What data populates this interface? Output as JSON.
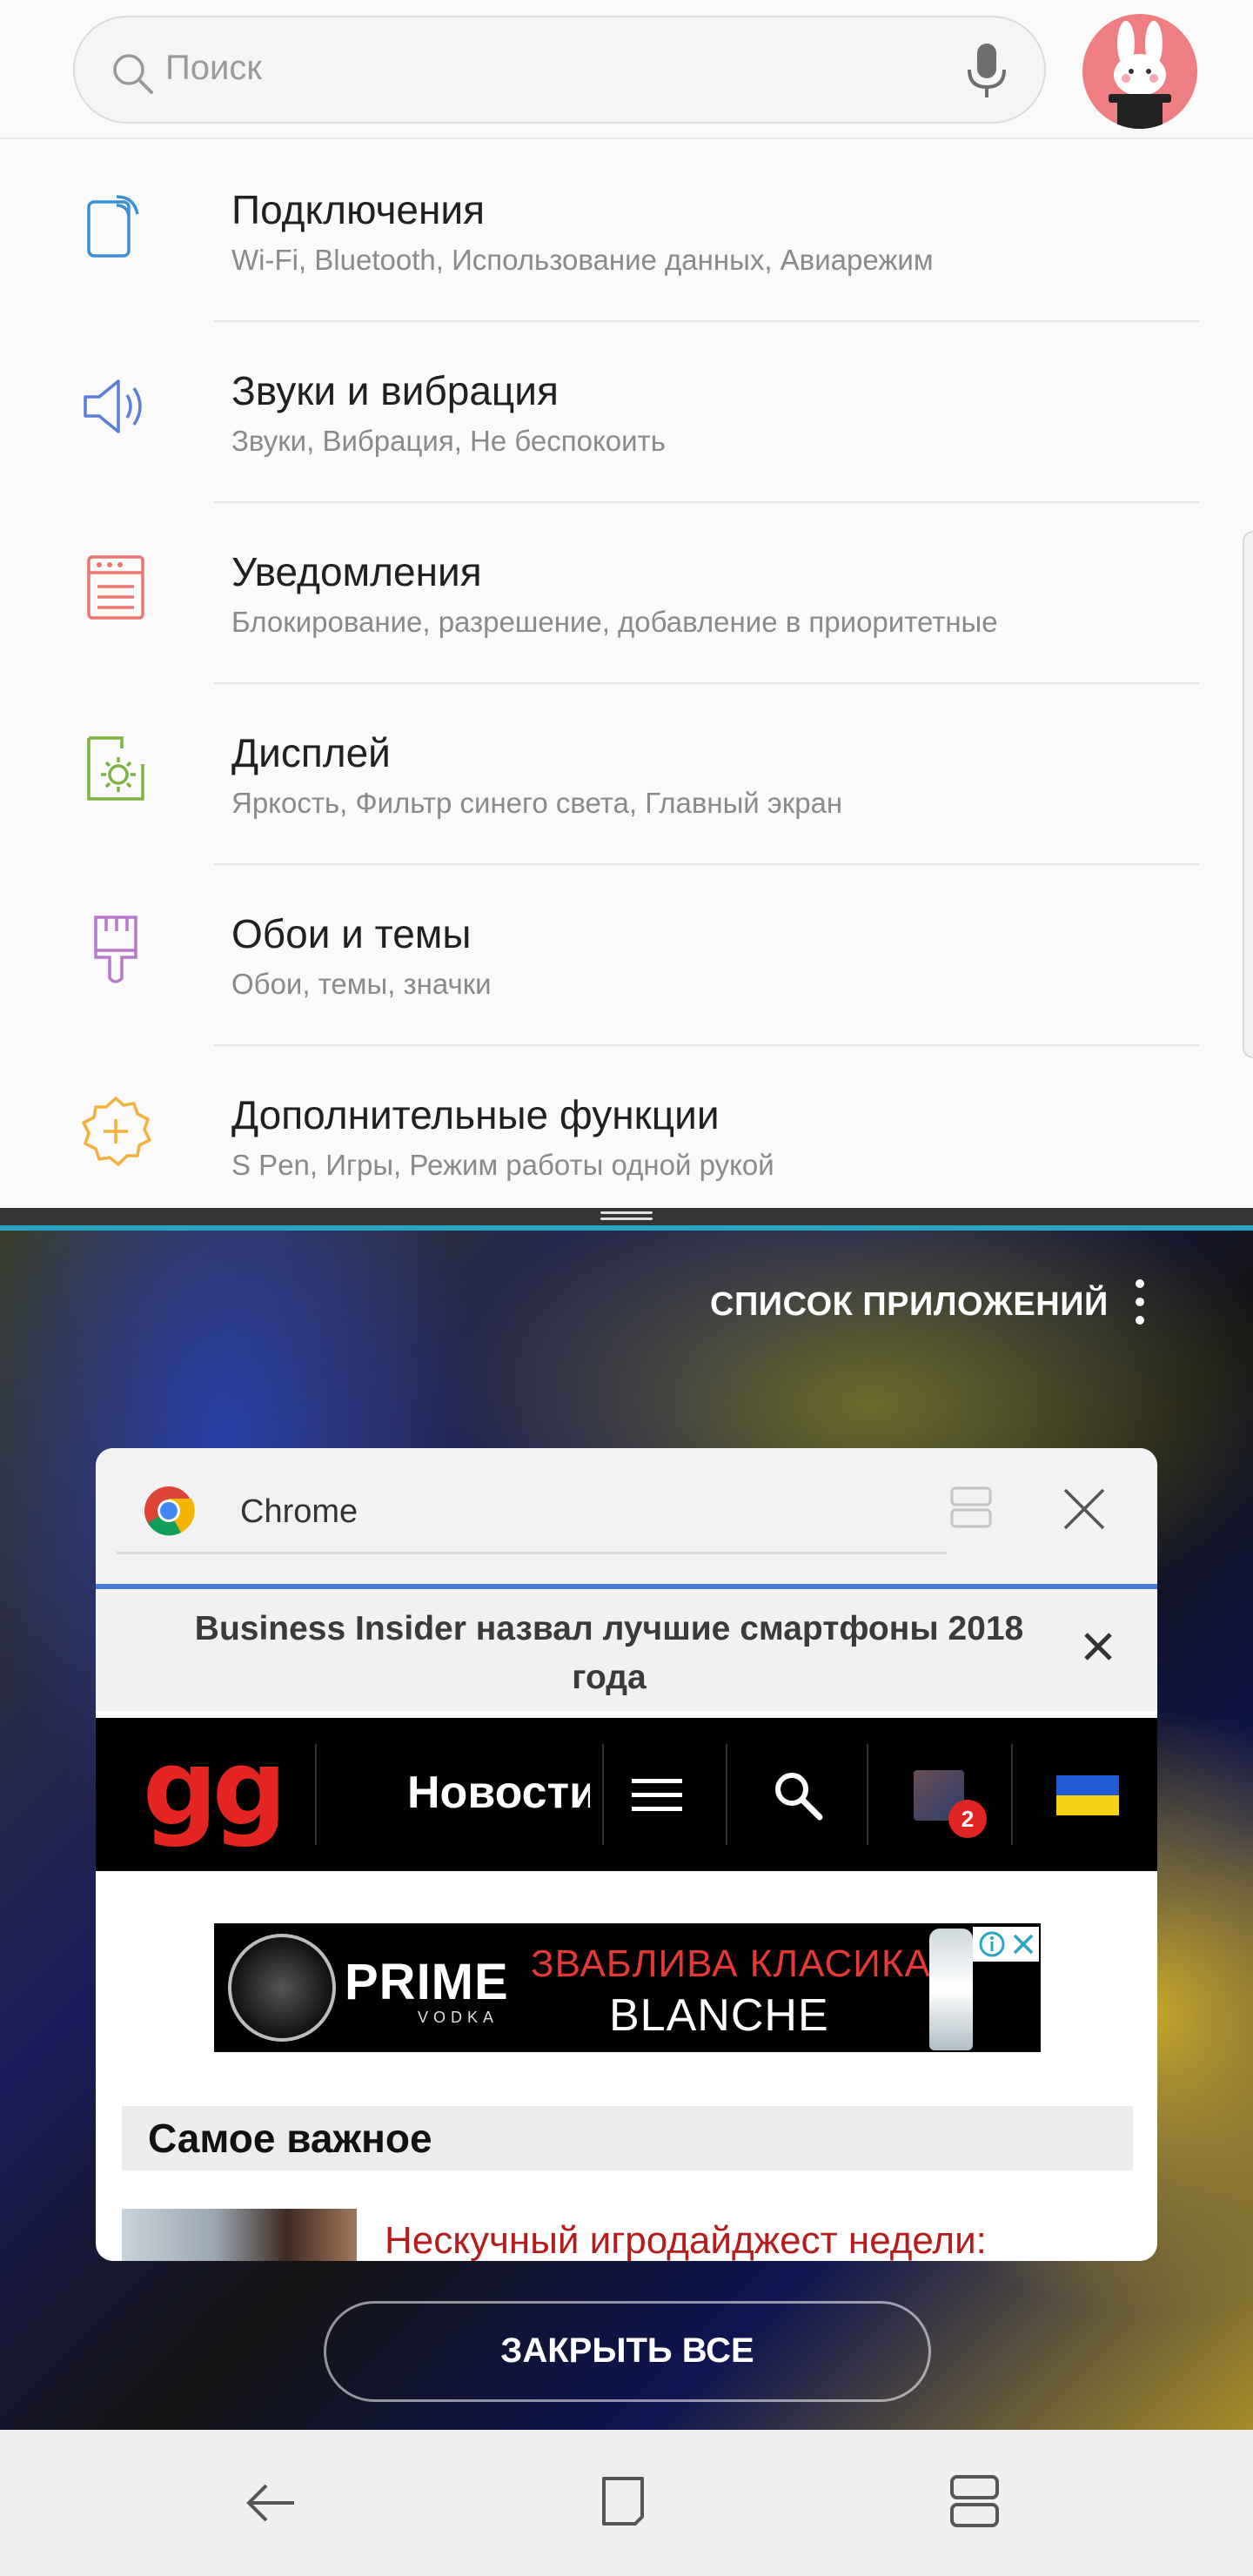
{
  "settings": {
    "search": {
      "placeholder": "Поиск"
    },
    "items": [
      {
        "title": "Подключения",
        "subtitle": "Wi-Fi, Bluetooth, Использование данных, Авиарежим",
        "icon": "connections-icon",
        "color": "#3d8fd1"
      },
      {
        "title": "Звуки и вибрация",
        "subtitle": "Звуки, Вибрация, Не беспокоить",
        "icon": "sound-icon",
        "color": "#5a7fd6"
      },
      {
        "title": "Уведомления",
        "subtitle": "Блокирование, разрешение, добавление в приоритетные",
        "icon": "notifications-icon",
        "color": "#e8766e"
      },
      {
        "title": "Дисплей",
        "subtitle": "Яркость, Фильтр синего света, Главный экран",
        "icon": "display-icon",
        "color": "#7cb342"
      },
      {
        "title": "Обои и темы",
        "subtitle": "Обои, темы, значки",
        "icon": "wallpaper-brush-icon",
        "color": "#b77acb"
      },
      {
        "title": "Дополнительные функции",
        "subtitle": "S Pen, Игры, Режим работы одной рукой",
        "icon": "advanced-features-icon",
        "color": "#f2b13a"
      }
    ]
  },
  "recents": {
    "app_list_label": "СПИСОК ПРИЛОЖЕНИЙ",
    "close_all_label": "ЗАКРЫТЬ ВСЕ",
    "card": {
      "app_name": "Chrome",
      "notice": "Business Insider назвал лучшие смартфоны 2018 года",
      "site": {
        "logo": "gg",
        "nav_news": "Новости",
        "notification_count": "2",
        "ad": {
          "brand": "PRIME",
          "brand_sub": "VODKA",
          "line1": "ЗВАБЛИВА КЛАСИКА",
          "line2": "BLANCHE"
        },
        "section_heading": "Самое важное",
        "article_title": "Нескучный игродайджест недели:"
      }
    }
  },
  "colors": {
    "logo_red": "#e52521",
    "accent_blue": "#4a7bd8",
    "split_accent": "#2aa6c4"
  }
}
